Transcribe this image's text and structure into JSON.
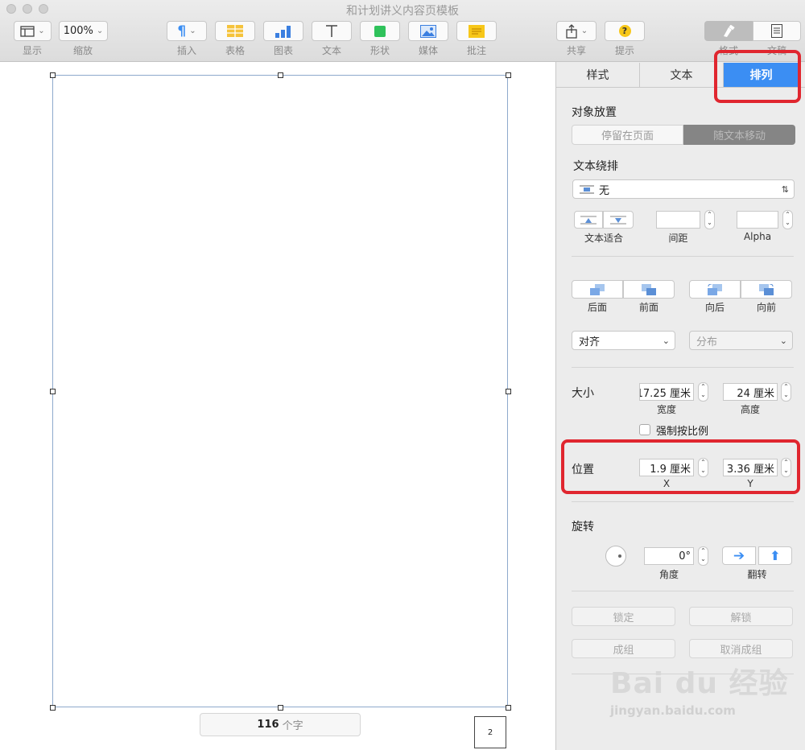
{
  "window": {
    "title": "和计划讲义内容页模板"
  },
  "toolbar": {
    "view_label": "显示",
    "zoom_value": "100%",
    "zoom_label": "缩放",
    "insert_label": "插入",
    "table_label": "表格",
    "chart_label": "图表",
    "text_label": "文本",
    "shape_label": "形状",
    "media_label": "媒体",
    "comment_label": "批注",
    "share_label": "共享",
    "tips_label": "提示",
    "format_label": "格式",
    "document_label": "文稿"
  },
  "inspector": {
    "tabs": [
      "样式",
      "文本",
      "排列"
    ],
    "active_tab": "排列",
    "object_placement": {
      "title": "对象放置",
      "stay_on_page": "停留在页面",
      "move_with_text": "随文本移动"
    },
    "text_wrap": {
      "title": "文本绕排",
      "value": "无",
      "text_fit_label": "文本适合",
      "spacing_label": "间距",
      "alpha_label": "Alpha"
    },
    "layer": {
      "back": "后面",
      "front": "前面",
      "backward": "向后",
      "forward": "向前"
    },
    "align_label": "对齐",
    "distribute_label": "分布",
    "size": {
      "title": "大小",
      "width_value": "17.25 厘米",
      "width_label": "宽度",
      "height_value": "24 厘米",
      "height_label": "高度",
      "constrain_label": "强制按比例"
    },
    "position": {
      "title": "位置",
      "x_value": "1.9 厘米",
      "x_label": "X",
      "y_value": "3.36 厘米",
      "y_label": "Y"
    },
    "rotate": {
      "title": "旋转",
      "angle_value": "0°",
      "angle_label": "角度",
      "flip_label": "翻转"
    },
    "lock": "锁定",
    "unlock": "解锁",
    "group": "成组",
    "ungroup": "取消成组"
  },
  "status": {
    "word_count": "116",
    "word_unit": "个字",
    "page_number": "2"
  },
  "watermark": {
    "brand": "Bai du 经验",
    "url": "jingyan.baidu.com"
  },
  "colors": {
    "accent": "#3b8ef3",
    "highlight": "#e0262f"
  }
}
